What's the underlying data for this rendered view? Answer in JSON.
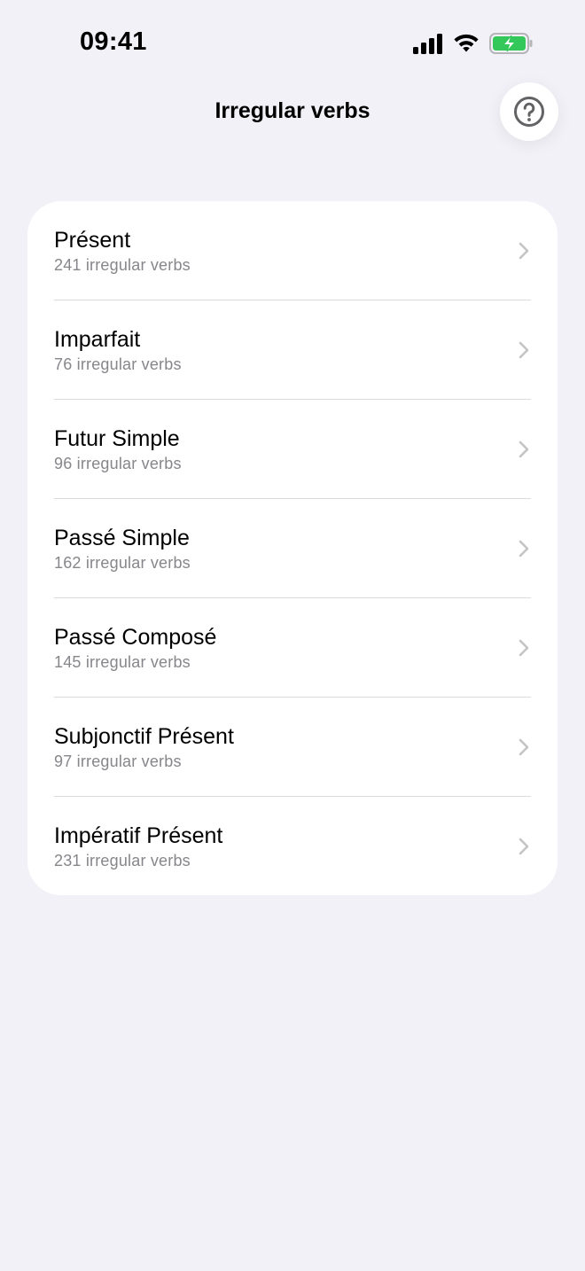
{
  "status_bar": {
    "time": "09:41",
    "icons": [
      "cellular-signal-icon",
      "wifi-icon",
      "battery-charging-icon"
    ],
    "battery_color": "#34c759"
  },
  "header": {
    "title": "Irregular verbs",
    "help_icon": "question-circle-icon"
  },
  "tenses": [
    {
      "name": "Présent",
      "count_label": "241 irregular verbs"
    },
    {
      "name": "Imparfait",
      "count_label": "76 irregular verbs"
    },
    {
      "name": "Futur Simple",
      "count_label": "96 irregular verbs"
    },
    {
      "name": "Passé Simple",
      "count_label": "162 irregular verbs"
    },
    {
      "name": "Passé Composé",
      "count_label": "145 irregular verbs"
    },
    {
      "name": "Subjonctif Présent",
      "count_label": "97 irregular verbs"
    },
    {
      "name": "Impératif Présent",
      "count_label": "231 irregular verbs"
    }
  ],
  "colors": {
    "background": "#f2f1f7",
    "card": "#ffffff",
    "secondary_text": "#86868b",
    "chevron": "#c4c4c7"
  }
}
